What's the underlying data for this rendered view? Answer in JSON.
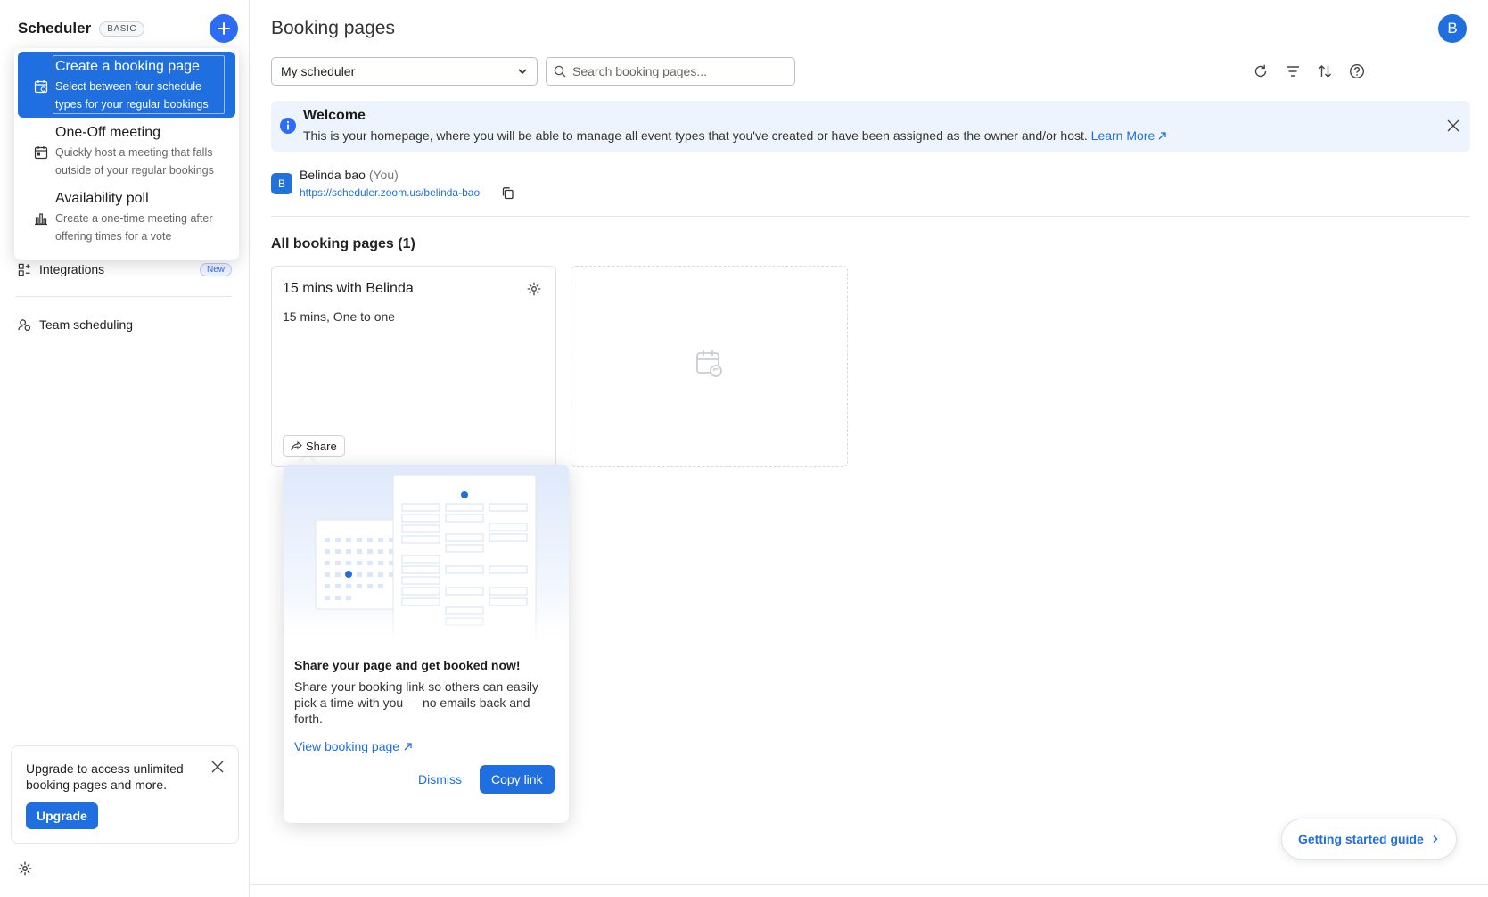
{
  "sidebar": {
    "app_name": "Scheduler",
    "plan_badge": "BASIC",
    "create_menu": [
      {
        "title": "Create a booking page",
        "desc_1": "Select between four schedule",
        "desc_2": "types for your regular bookings"
      },
      {
        "title": "One-Off meeting",
        "desc_1": "Quickly host a meeting that falls",
        "desc_2": "outside of your regular bookings"
      },
      {
        "title": "Availability poll",
        "desc_1": "Create a one-time meeting after",
        "desc_2": "offering times for a vote"
      }
    ],
    "nav": {
      "integrations": "Integrations",
      "integrations_badge": "New",
      "team_scheduling": "Team scheduling"
    },
    "upgrade": {
      "text": "Upgrade to access unlimited booking pages and more.",
      "button": "Upgrade"
    }
  },
  "header": {
    "title": "Booking pages",
    "avatar_initial": "B"
  },
  "filters": {
    "scheduler_select": "My scheduler",
    "search_placeholder": "Search booking pages..."
  },
  "welcome": {
    "title": "Welcome",
    "body": "This is your homepage, where you will be able to manage all event types that you've created or have been assigned as the owner and/or host.",
    "link": "Learn More"
  },
  "user": {
    "initial": "B",
    "name": "Belinda bao",
    "you_label": "(You)",
    "url": "https://scheduler.zoom.us/belinda-bao"
  },
  "booking_pages": {
    "section_title": "All booking pages (1)",
    "cards": [
      {
        "title": "15 mins with Belinda",
        "subtitle": "15 mins, One to one",
        "share_label": "Share"
      }
    ]
  },
  "share_popover": {
    "title": "Share your page and get booked now!",
    "body": "Share your booking link so others can easily pick a time with you — no emails back and forth.",
    "link": "View booking page",
    "dismiss": "Dismiss",
    "copy": "Copy link"
  },
  "guide_button": "Getting started guide",
  "colors": {
    "primary": "#1f6fe0",
    "accent": "#2d6df6",
    "welcome_bg": "#eef4fd"
  }
}
